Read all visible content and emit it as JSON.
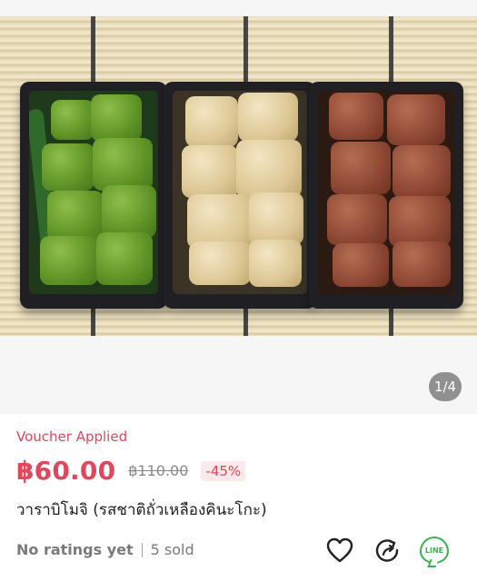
{
  "gallery": {
    "counter": "1/4",
    "photo_icon": "product-photo"
  },
  "product": {
    "voucher_label": "Voucher Applied",
    "price": "฿60.00",
    "original_price": "฿110.00",
    "discount": "-45%",
    "title": "วาราบิโมจิ (รสชาติถั่วเหลืองคินะโกะ)",
    "ratings": "No ratings yet",
    "sold": "5 sold"
  },
  "actions": {
    "favorite_icon": "heart-icon",
    "share_icon": "share-icon",
    "line_icon": "line-share-icon",
    "line_label": "LINE"
  },
  "colors": {
    "accent": "#e0475b",
    "line_green": "#37b24d",
    "muted": "#7a7a7a"
  }
}
